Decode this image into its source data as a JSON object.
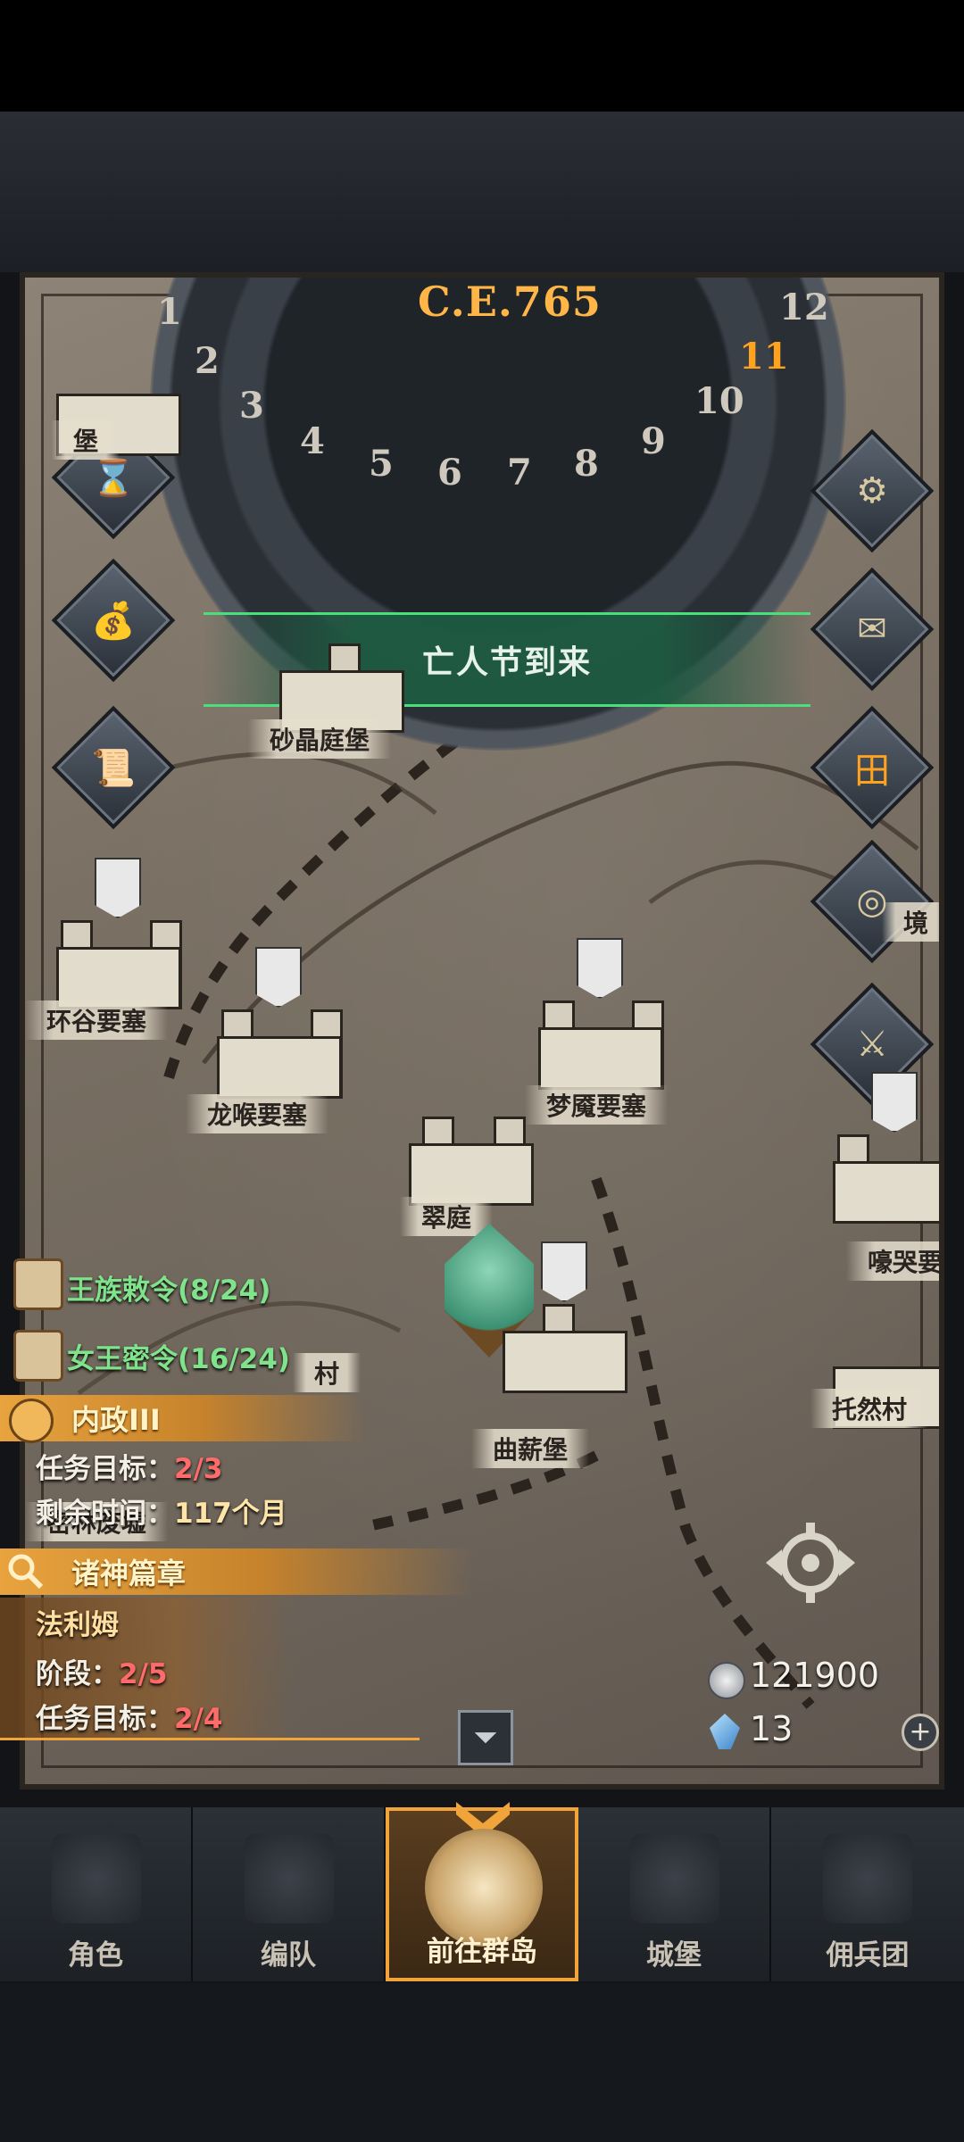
{
  "header": {
    "year": "C.E.765"
  },
  "wheel": {
    "months": [
      "1",
      "2",
      "3",
      "4",
      "5",
      "6",
      "7",
      "8",
      "9",
      "10",
      "11",
      "12"
    ],
    "current_month": "11"
  },
  "event_banner": {
    "text": "亡人节到来"
  },
  "locations": {
    "bottom_left_top": "堡",
    "shajing": "砂晶庭堡",
    "huangu": "环谷要塞",
    "longhou": "龙喉要塞",
    "mengyan": "梦魇要塞",
    "cuiting": "翠庭",
    "haoku": "嚎哭要塞",
    "tuoran": "托然村",
    "quxin": "曲薪堡",
    "milin": "密林废墟",
    "village_right_partial": "境",
    "village_mid": "村"
  },
  "quests": {
    "royal_order": {
      "title": "王族敕令",
      "progress": "(8/24)"
    },
    "queen_order": {
      "title": "女王密令",
      "progress": "(16/24)"
    },
    "domestic": {
      "header": "内政III",
      "goal_label": "任务目标：",
      "goal_value": "2/3",
      "time_label": "剩余时间：",
      "time_value": "117个月"
    },
    "gods": {
      "header": "诸神篇章",
      "hero": "法利姆",
      "stage_label": "阶段：",
      "stage_value": "2/5",
      "goal_label": "任务目标：",
      "goal_value": "2/4"
    }
  },
  "resources": {
    "silver": "121900",
    "crystals": "13"
  },
  "nav": {
    "tabs": [
      "角色",
      "编队",
      "前往群岛",
      "城堡",
      "佣兵团"
    ],
    "active": "前往群岛"
  },
  "icons": [
    "hourglass-icon",
    "money-bag-icon",
    "scroll-icon",
    "gear-icon",
    "mail-icon",
    "shop-icon",
    "coin-icon",
    "helmet-sword-icon",
    "locate-icon",
    "collapse-icon",
    "plus-icon"
  ],
  "colors": {
    "accent_gold": "#f0a43a",
    "quest_green": "#7fe38b",
    "progress_red": "#ff6b6b",
    "event_green": "#49e07c"
  }
}
